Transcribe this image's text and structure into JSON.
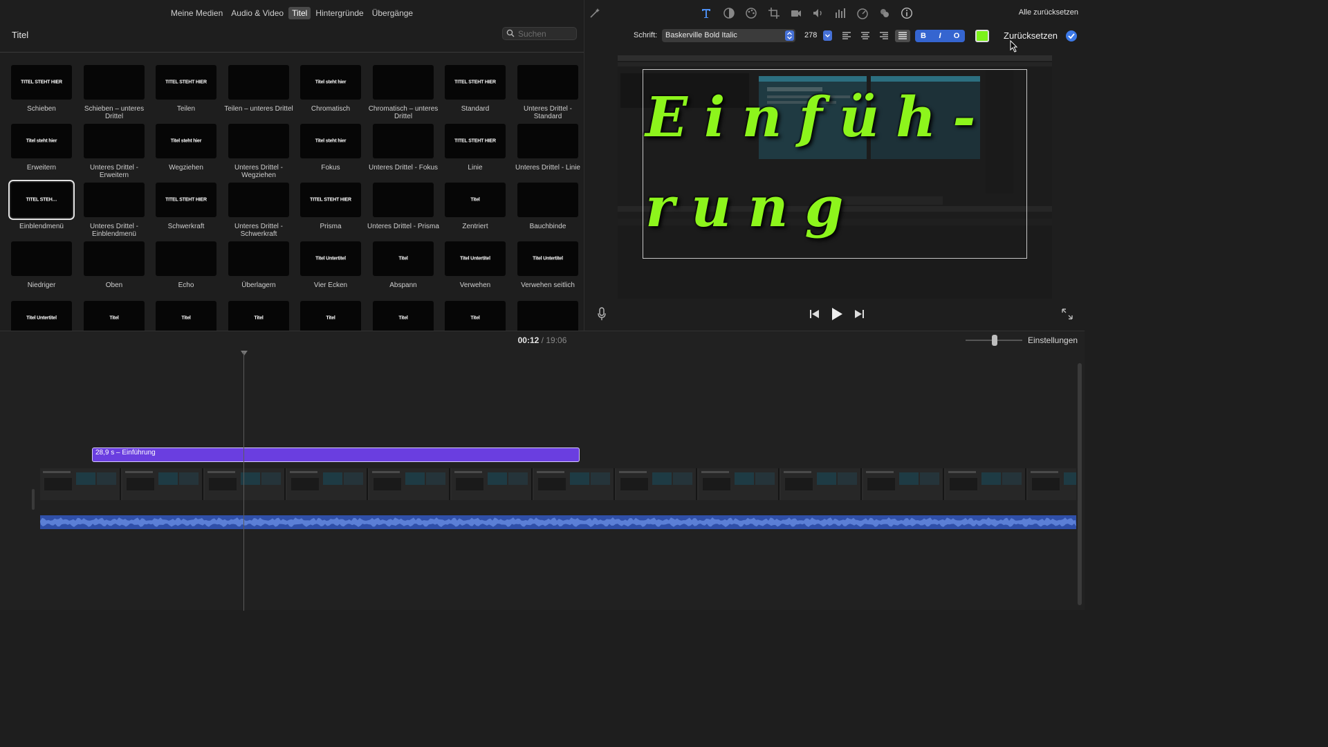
{
  "media_tabs": [
    "Meine Medien",
    "Audio & Video",
    "Titel",
    "Hintergründe",
    "Übergänge"
  ],
  "active_tab": "Titel",
  "browser": {
    "title": "Titel",
    "search_placeholder": "Suchen"
  },
  "titles": [
    {
      "label": "Schieben",
      "thumb": "TITEL STEHT HIER"
    },
    {
      "label": "Schieben – unteres Drittel",
      "thumb": ""
    },
    {
      "label": "Teilen",
      "thumb": "TITEL STEHT HIER"
    },
    {
      "label": "Teilen – unteres Drittel",
      "thumb": ""
    },
    {
      "label": "Chromatisch",
      "thumb": "Titel steht hier"
    },
    {
      "label": "Chromatisch – unteres Drittel",
      "thumb": ""
    },
    {
      "label": "Standard",
      "thumb": "TITEL STEHT HIER"
    },
    {
      "label": "Unteres Drittel - Standard",
      "thumb": ""
    },
    {
      "label": "Erweitern",
      "thumb": "Titel steht hier"
    },
    {
      "label": "Unteres Drittel - Erweitern",
      "thumb": ""
    },
    {
      "label": "Wegziehen",
      "thumb": "Titel steht hier"
    },
    {
      "label": "Unteres Drittel - Wegziehen",
      "thumb": ""
    },
    {
      "label": "Fokus",
      "thumb": "Titel steht hier"
    },
    {
      "label": "Unteres Drittel - Fokus",
      "thumb": ""
    },
    {
      "label": "Linie",
      "thumb": "TITEL STEHT HIER"
    },
    {
      "label": "Unteres Drittel - Linie",
      "thumb": ""
    },
    {
      "label": "Einblendmenü",
      "thumb": "TITEL STEH…"
    },
    {
      "label": "Unteres Drittel - Einblendmenü",
      "thumb": ""
    },
    {
      "label": "Schwerkraft",
      "thumb": "TITEL STEHT HIER"
    },
    {
      "label": "Unteres Drittel - Schwerkraft",
      "thumb": ""
    },
    {
      "label": "Prisma",
      "thumb": "TITEL STEHT HIER"
    },
    {
      "label": "Unteres Drittel - Prisma",
      "thumb": ""
    },
    {
      "label": "Zentriert",
      "thumb": "Titel"
    },
    {
      "label": "Bauchbinde",
      "thumb": ""
    },
    {
      "label": "Niedriger",
      "thumb": ""
    },
    {
      "label": "Oben",
      "thumb": ""
    },
    {
      "label": "Echo",
      "thumb": ""
    },
    {
      "label": "Überlagern",
      "thumb": ""
    },
    {
      "label": "Vier Ecken",
      "thumb": "Titel Untertitel"
    },
    {
      "label": "Abspann",
      "thumb": "Titel"
    },
    {
      "label": "Verwehen",
      "thumb": "Titel Untertitel"
    },
    {
      "label": "Verwehen seitlich",
      "thumb": "Titel Untertitel"
    },
    {
      "label": "",
      "thumb": "Titel Untertitel"
    },
    {
      "label": "",
      "thumb": "Titel"
    },
    {
      "label": "",
      "thumb": "Titel"
    },
    {
      "label": "",
      "thumb": "Titel"
    },
    {
      "label": "",
      "thumb": "Titel"
    },
    {
      "label": "",
      "thumb": "Titel"
    },
    {
      "label": "",
      "thumb": "Titel"
    },
    {
      "label": "",
      "thumb": ""
    }
  ],
  "selected_title": "Einblendmenü",
  "viewer": {
    "reset_all": "Alle zurücksetzen",
    "font_label": "Schrift:",
    "font_name": "Baskerville Bold Italic",
    "font_size": "278",
    "bold": "B",
    "italic": "I",
    "outline": "O",
    "text_color": "#7cf21a",
    "reset": "Zurücksetzen",
    "title_text": "Einfüh-rung"
  },
  "timeline": {
    "current": "00:12",
    "separator": "/",
    "total": "19:06",
    "settings": "Einstellungen",
    "title_clip": "28,9 s – Einführung"
  },
  "colors": {
    "accent_blue": "#3d7ae8",
    "clip_purple": "#6a3ee0",
    "audio_blue": "#2f4fa8",
    "title_green": "#8df51c"
  }
}
